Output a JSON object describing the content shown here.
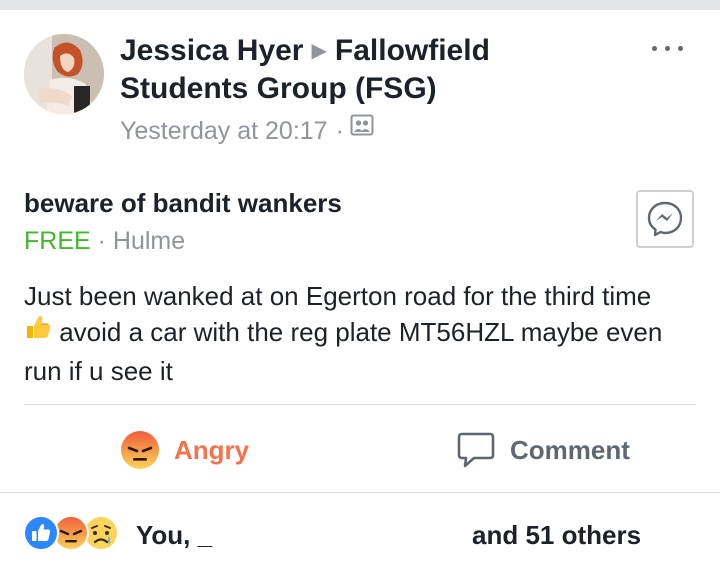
{
  "post": {
    "author": "Jessica Hyer",
    "group_line1": "Fallowfield",
    "group_line2": "Students Group (FSG)",
    "timestamp": "Yesterday at 20:17",
    "audience_icon": "group-audience-icon",
    "more_icon": "more-options-icon"
  },
  "listing": {
    "title": "beware of bandit wankers",
    "price": "FREE",
    "location": "Hulme",
    "message_icon": "messenger-icon"
  },
  "body": {
    "part1": "Just been wanked at on Egerton road for the third time",
    "emoji_icon": "thumbs-up-emoji",
    "part2": " avoid a car with the reg plate MT56HZL maybe even run if u see it"
  },
  "actions": {
    "reaction_label": "Angry",
    "comment_label": "Comment"
  },
  "summary": {
    "you_text": "You, _",
    "others_text": "and 51 others",
    "icons": [
      "like-reaction-icon",
      "angry-reaction-icon",
      "sad-reaction-icon"
    ]
  },
  "colors": {
    "price_green": "#42b72a",
    "angry_orange": "#f7714c",
    "meta_gray": "#90949c",
    "like_blue": "#2d88ff"
  }
}
